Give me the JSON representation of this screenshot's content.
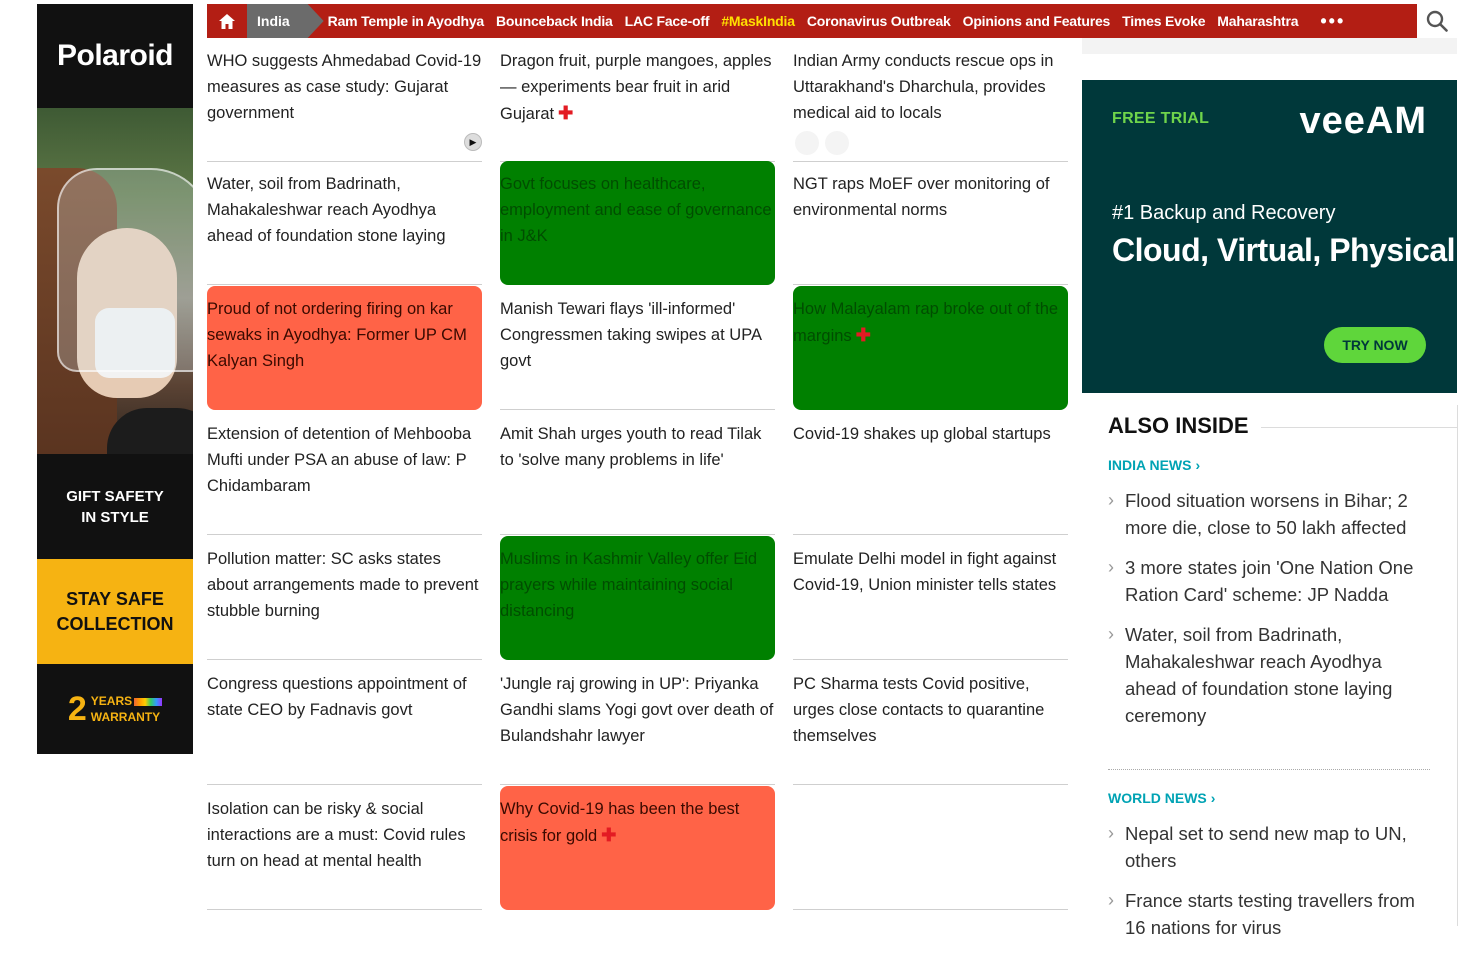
{
  "left_ad": {
    "brand": "Polaroid",
    "gift_text": "GIFT SAFETY IN STYLE",
    "stay_text": "STAY SAFE COLLECTION",
    "warranty_number": "2",
    "warranty_word1": "YEARS",
    "warranty_word2": "WARRANTY"
  },
  "nav": {
    "current": "India",
    "items": [
      {
        "label": "Ram Temple in Ayodhya",
        "highlight": false
      },
      {
        "label": "Bounceback India",
        "highlight": false
      },
      {
        "label": "LAC Face-off",
        "highlight": false
      },
      {
        "label": "#MaskIndia",
        "highlight": true
      },
      {
        "label": "Coronavirus Outbreak",
        "highlight": false
      },
      {
        "label": "Opinions and Features",
        "highlight": false
      },
      {
        "label": "Times Evoke",
        "highlight": false
      },
      {
        "label": "Maharashtra",
        "highlight": false
      }
    ],
    "more": "•••",
    "icons": [
      "home-icon",
      "search-icon",
      "more-icon"
    ]
  },
  "articles": [
    {
      "title": "WHO suggests Ahmedabad Covid-19 measures as case study: Gujarat government",
      "style": "plain",
      "plus": false
    },
    {
      "title": "Dragon fruit, purple mangoes, apples — experiments bear fruit in arid Gujarat",
      "style": "plain",
      "plus": true
    },
    {
      "title": "Indian Army conducts rescue ops in Uttarakhand's Dharchula, provides medical aid to locals",
      "style": "plain",
      "plus": false
    },
    {
      "title": "Water, soil from Badrinath, Mahakaleshwar reach Ayodhya ahead of foundation stone laying",
      "style": "plain",
      "plus": false
    },
    {
      "title": "Govt focuses on healthcare, employment and ease of governance in J&K",
      "style": "green",
      "plus": false
    },
    {
      "title": "NGT raps MoEF over monitoring of environmental norms",
      "style": "plain",
      "plus": false
    },
    {
      "title": "Proud of not ordering firing on kar sewaks in Ayodhya: Former UP CM Kalyan Singh",
      "style": "red",
      "plus": false
    },
    {
      "title": "Manish Tewari flays 'ill-informed' Congressmen taking swipes at UPA govt",
      "style": "plain",
      "plus": false
    },
    {
      "title": "How Malayalam rap broke out of the margins",
      "style": "green",
      "plus": true
    },
    {
      "title": "Extension of detention of Mehbooba Mufti under PSA an abuse of law: P Chidambaram",
      "style": "plain",
      "plus": false
    },
    {
      "title": "Amit Shah urges youth to read Tilak to 'solve many problems in life'",
      "style": "plain",
      "plus": false
    },
    {
      "title": "Covid-19 shakes up global startups",
      "style": "plain",
      "plus": false
    },
    {
      "title": "Pollution matter: SC asks states about arrangements made to prevent stubble burning",
      "style": "plain",
      "plus": false
    },
    {
      "title": "Muslims in Kashmir Valley offer Eid prayers while maintaining social distancing",
      "style": "green",
      "plus": false
    },
    {
      "title": "Emulate Delhi model in fight against Covid-19, Union minister tells states",
      "style": "plain",
      "plus": false
    },
    {
      "title": "Congress questions appointment of state CEO by Fadnavis govt",
      "style": "plain",
      "plus": false
    },
    {
      "title": "'Jungle raj growing in UP': Priyanka Gandhi slams Yogi govt over death of Bulandshahr lawyer",
      "style": "plain",
      "plus": false
    },
    {
      "title": "PC Sharma tests Covid positive, urges close contacts to quarantine themselves",
      "style": "plain",
      "plus": false
    },
    {
      "title": "Isolation can be risky & social interactions are a must: Covid rules turn on head at mental health",
      "style": "plain",
      "plus": false
    },
    {
      "title": "Why Covid-19 has been the best crisis for gold",
      "style": "red",
      "plus": true
    },
    {
      "title": "",
      "style": "plain",
      "plus": false
    }
  ],
  "right_ad": {
    "free_trial": "FREE TRIAL",
    "brand": "veeAM",
    "subtitle": "#1 Backup and Recovery",
    "headline": "Cloud, Virtual, Physical",
    "cta": "TRY NOW"
  },
  "also_inside": {
    "title": "ALSO INSIDE",
    "india_label": "INDIA NEWS",
    "india_items": [
      "Flood situation worsens in Bihar; 2 more die, close to 50 lakh affected",
      "3 more states join 'One Nation One Ration Card' scheme: JP Nadda",
      "Water, soil from Badrinath, Mahakaleshwar reach Ayodhya ahead of foundation stone laying ceremony"
    ],
    "world_label": "WORLD NEWS",
    "world_items": [
      "Nepal set to send new map to UN, others",
      "France starts testing travellers from 16 nations for virus"
    ],
    "chevron": "›"
  },
  "colors": {
    "nav_bg": "#b31e14",
    "nav_active": "#6b6b6b",
    "highlight_nav": "#ffe000",
    "green_card": "#008000",
    "red_card": "#ff6347",
    "section_label": "#00a3b4",
    "ad_accent": "#f6b312",
    "veeam_bg": "#00383a",
    "veeam_green": "#5fd63b"
  }
}
